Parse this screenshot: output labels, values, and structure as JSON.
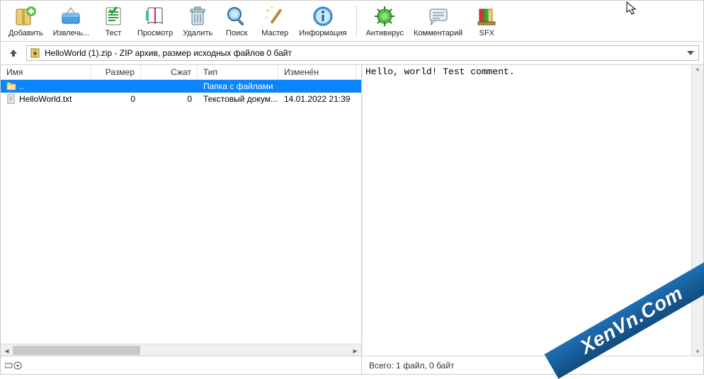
{
  "toolbar": {
    "buttons": [
      {
        "id": "add",
        "label": "Добавить"
      },
      {
        "id": "extract",
        "label": "Извлечь..."
      },
      {
        "id": "test",
        "label": "Тест"
      },
      {
        "id": "view",
        "label": "Просмотр"
      },
      {
        "id": "delete",
        "label": "Удалить"
      },
      {
        "id": "find",
        "label": "Поиск"
      },
      {
        "id": "wizard",
        "label": "Мастер"
      },
      {
        "id": "info",
        "label": "Информация"
      },
      {
        "id": "virus",
        "label": "Антивирус"
      },
      {
        "id": "comment",
        "label": "Комментарий"
      },
      {
        "id": "sfx",
        "label": "SFX"
      }
    ]
  },
  "address": {
    "path": "HelloWorld (1).zip - ZIP архив, размер исходных файлов 0 байт"
  },
  "columns": {
    "name": "Имя",
    "size": "Размер",
    "packed": "Сжат",
    "type": "Тип",
    "modified": "Изменён"
  },
  "rows": [
    {
      "sel": true,
      "icon": "folder-up",
      "name": "..",
      "size": "",
      "packed": "",
      "type": "Папка с файлами",
      "modified": ""
    },
    {
      "sel": false,
      "icon": "txt-file",
      "name": "HelloWorld.txt",
      "size": "0",
      "packed": "0",
      "type": "Текстовый докум...",
      "modified": "14.01.2022 21:39"
    }
  ],
  "comment": "Hello, world! Test comment.",
  "status": {
    "total": "Всего: 1 файл, 0 байт"
  },
  "watermark": "XenVn.Com"
}
